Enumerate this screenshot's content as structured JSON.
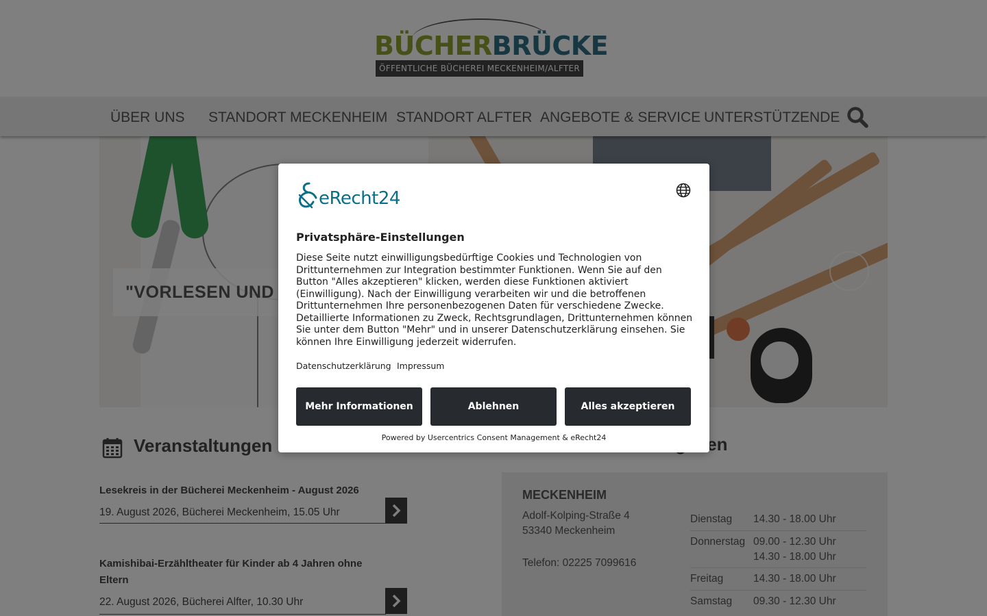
{
  "header": {
    "logo_part1": "BÜCHER",
    "logo_part2": "BRÜCKE",
    "logo_subtitle": "ÖFFENTLICHE BÜCHEREI MECKENHEIM/ALFTER"
  },
  "nav": {
    "items": [
      {
        "label": "ÜBER UNS"
      },
      {
        "label": "STANDORT MECKENHEIM"
      },
      {
        "label": "STANDORT ALFTER"
      },
      {
        "label": "ANGEBOTE & SERVICE"
      },
      {
        "label": "UNTERSTÜTZENDE"
      }
    ],
    "search_icon": "search-icon"
  },
  "hero": {
    "caption": "\"VORLESEN UND"
  },
  "events": {
    "title": "Veranstaltungen",
    "icon": "calendar-icon",
    "items": [
      {
        "title": "Lesekreis in der Bücherei Meckenheim - August 2026",
        "meta": "19. August 2026, Bücherei Meckenheim, 15.05 Uhr"
      },
      {
        "title": "Kamishibai-Erzähltheater für Kinder ab 4 Jahren ohne Eltern",
        "meta": "22. August 2026, Bücherei Alfter, 10.30 Uhr"
      }
    ]
  },
  "hours": {
    "title_visible": "geiten",
    "location": "MECKENHEIM",
    "address_line1": "Adolf-Kolping-Straße 4",
    "address_line2": "53340 Meckenheim",
    "phone": "Telefon: 02225 7099616",
    "rows": [
      {
        "day": "Dienstag",
        "time": "14.30 - 18.00 Uhr"
      },
      {
        "day": "Donnerstag",
        "time": "09.00 - 12.30 Uhr",
        "time2": "14.30 - 18.00 Uhr"
      },
      {
        "day": "Freitag",
        "time": "14.30 - 18.00 Uhr"
      },
      {
        "day": "Samstag",
        "time": "09.30 - 12.30 Uhr"
      }
    ]
  },
  "consent": {
    "brand": "eRecht24",
    "heading": "Privatsphäre-Einstellungen",
    "body": "Diese Seite nutzt einwilligungsbedürftige Cookies und Technologien von Drittunternehmen zur Integration bestimmter Funktionen. Wenn Sie auf den Button \"Alles akzeptieren\" klicken, werden diese Funktionen aktiviert (Einwilligung). Nach der Einwilligung verarbeiten wir und die betroffenen Drittunternehmen Ihre personenbezogenen Daten für verschiedene Zwecke. Detaillierte Informationen zu Zweck, Rechtsgrundlagen, Drittunternehmen können Sie unter dem Button \"Mehr\" und in unserer Datenschutzerklärung einsehen. Sie können Ihre Einwilligung jederzeit widerrufen.",
    "link_privacy": "Datenschutzerklärung",
    "link_imprint": "Impressum",
    "btn_more": "Mehr Informationen",
    "btn_decline": "Ablehnen",
    "btn_accept": "Alles akzeptieren",
    "powered": "Powered by Usercentrics Consent Management & eRecht24",
    "colors": {
      "button": "#272a2e",
      "brand": "#0c6f88"
    }
  }
}
